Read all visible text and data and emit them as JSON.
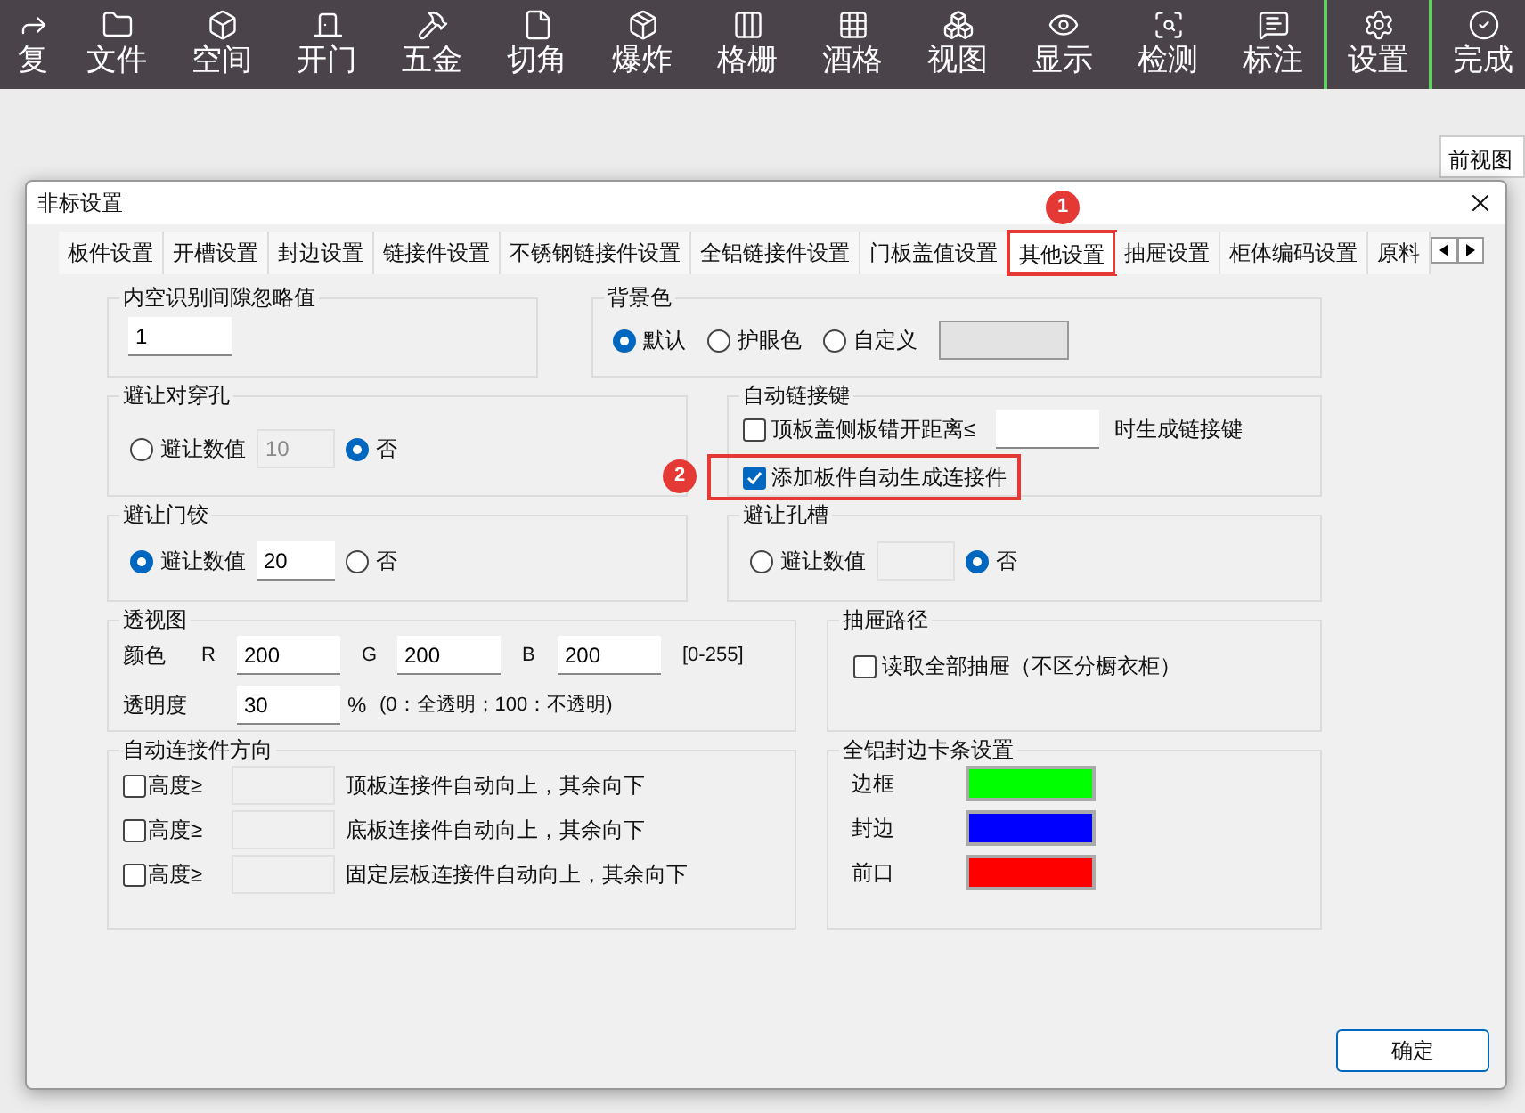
{
  "toolbar": [
    {
      "label": "复",
      "divider": false
    },
    {
      "label": "文件",
      "divider": false
    },
    {
      "label": "空间",
      "divider": false
    },
    {
      "label": "开门",
      "divider": false
    },
    {
      "label": "五金",
      "divider": false
    },
    {
      "label": "切角",
      "divider": false
    },
    {
      "label": "爆炸",
      "divider": false
    },
    {
      "label": "格栅",
      "divider": false
    },
    {
      "label": "酒格",
      "divider": false
    },
    {
      "label": "视图",
      "divider": false
    },
    {
      "label": "显示",
      "divider": false
    },
    {
      "label": "检测",
      "divider": false
    },
    {
      "label": "标注",
      "divider": false
    },
    {
      "label": "设置",
      "divider": true
    },
    {
      "label": "完成",
      "divider": true
    }
  ],
  "background_tab": {
    "label": "前视图"
  },
  "dialog": {
    "title": "非标设置",
    "tabs": [
      {
        "label": "板件设置",
        "selected": false,
        "highlighted": false
      },
      {
        "label": "开槽设置",
        "selected": false,
        "highlighted": false
      },
      {
        "label": "封边设置",
        "selected": false,
        "highlighted": false
      },
      {
        "label": "链接件设置",
        "selected": false,
        "highlighted": false
      },
      {
        "label": "不锈钢链接件设置",
        "selected": false,
        "highlighted": false
      },
      {
        "label": "全铝链接件设置",
        "selected": false,
        "highlighted": false
      },
      {
        "label": "门板盖值设置",
        "selected": false,
        "highlighted": false
      },
      {
        "label": "其他设置",
        "selected": true,
        "highlighted": true,
        "badge": "1"
      },
      {
        "label": "抽屉设置",
        "selected": false,
        "highlighted": false
      },
      {
        "label": "柜体编码设置",
        "selected": false,
        "highlighted": false
      },
      {
        "label": "原料",
        "selected": false,
        "highlighted": false
      }
    ],
    "gap_ignore": {
      "title": "内空识别间隙忽略值",
      "value": "1"
    },
    "background_color": {
      "title": "背景色",
      "options": [
        {
          "label": "默认",
          "selected": true
        },
        {
          "label": "护眼色",
          "selected": false
        },
        {
          "label": "自定义",
          "selected": false
        }
      ]
    },
    "avoid_through_hole": {
      "title": "避让对穿孔",
      "options": [
        {
          "label": "避让数值",
          "selected": false
        },
        {
          "label": "否",
          "selected": true
        }
      ],
      "value": "10",
      "disabled": true
    },
    "auto_link_key": {
      "title": "自动链接键",
      "items": [
        {
          "label": "顶板盖侧板错开距离≤",
          "checked": false,
          "highlighted": false,
          "suffix": "时生成链接键"
        },
        {
          "label": "添加板件自动生成连接件",
          "checked": true,
          "highlighted": true,
          "badge": "2"
        }
      ]
    },
    "avoid_hinge": {
      "title": "避让门铰",
      "options": [
        {
          "label": "避让数值",
          "selected": true
        },
        {
          "label": "否",
          "selected": false
        }
      ],
      "value": "20",
      "disabled": false
    },
    "avoid_slot": {
      "title": "避让孔槽",
      "options": [
        {
          "label": "避让数值",
          "selected": false
        },
        {
          "label": "否",
          "selected": true
        }
      ],
      "disabled": true
    },
    "perspective": {
      "title": "透视图",
      "color_label": "颜色",
      "channels": [
        {
          "label": "R",
          "value": "200"
        },
        {
          "label": "G",
          "value": "200"
        },
        {
          "label": "B",
          "value": "200"
        }
      ],
      "range": "[0-255]",
      "opacity_label": "透明度",
      "opacity_value": "30",
      "unit": "%",
      "note": "(0：全透明；100：不透明)"
    },
    "drawer_path": {
      "title": "抽屉路径",
      "label": "读取全部抽屉（不区分橱衣柜）",
      "checked": false
    },
    "connector_direction": {
      "title": "自动连接件方向",
      "rows": [
        {
          "label": "高度≥",
          "checked": false,
          "text": "顶板连接件自动向上，其余向下"
        },
        {
          "label": "高度≥",
          "checked": false,
          "text": "底板连接件自动向上，其余向下"
        },
        {
          "label": "高度≥",
          "checked": false,
          "text": "固定层板连接件自动向上，其余向下"
        }
      ]
    },
    "edge_strip": {
      "title": "全铝封边卡条设置",
      "rows": [
        {
          "label": "边框",
          "color": "#00ff00"
        },
        {
          "label": "封边",
          "color": "#0000ff"
        },
        {
          "label": "前口",
          "color": "#ff0000"
        }
      ]
    },
    "ok_button": "确定"
  }
}
